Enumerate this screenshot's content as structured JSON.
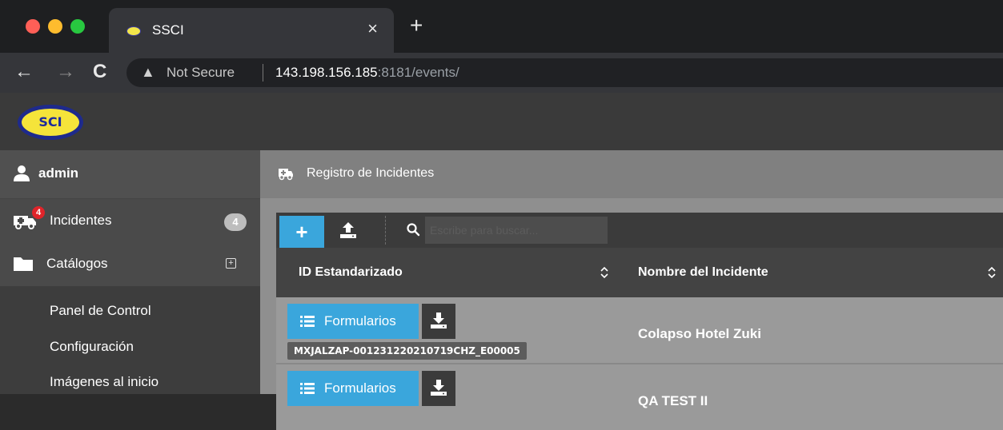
{
  "browser": {
    "tab_title": "SSCI",
    "tab_close": "×",
    "new_tab": "+",
    "security_label": "Not Secure",
    "url_host": "143.198.156.185",
    "url_rest": ":8181/events/"
  },
  "app": {
    "logo_text": "SCI"
  },
  "sidebar": {
    "user": "admin",
    "items": [
      {
        "label": "Incidentes",
        "badge": "4",
        "alert": "4"
      },
      {
        "label": "Catálogos",
        "expand": "+"
      }
    ],
    "submenu": [
      "Panel de Control",
      "Configuración",
      "Imágenes al inicio"
    ]
  },
  "main": {
    "page_title": "Registro de Incidentes",
    "toolbar": {
      "add_label": "+",
      "search_placeholder": "Escribe para buscar..."
    },
    "table": {
      "columns": [
        "ID Estandarizado",
        "Nombre del Incidente"
      ],
      "rows": [
        {
          "forms_label": "Formularios",
          "id": "MXJALZAP-001231220210719CHZ_E00005",
          "name": "Colapso Hotel Zuki"
        },
        {
          "forms_label": "Formularios",
          "id": "",
          "name": "QA TEST II"
        }
      ]
    }
  },
  "colors": {
    "accent": "#3aa6dc",
    "alert": "#e0242a",
    "logo_yellow": "#f5e43a",
    "logo_blue": "#1e2a8c"
  }
}
